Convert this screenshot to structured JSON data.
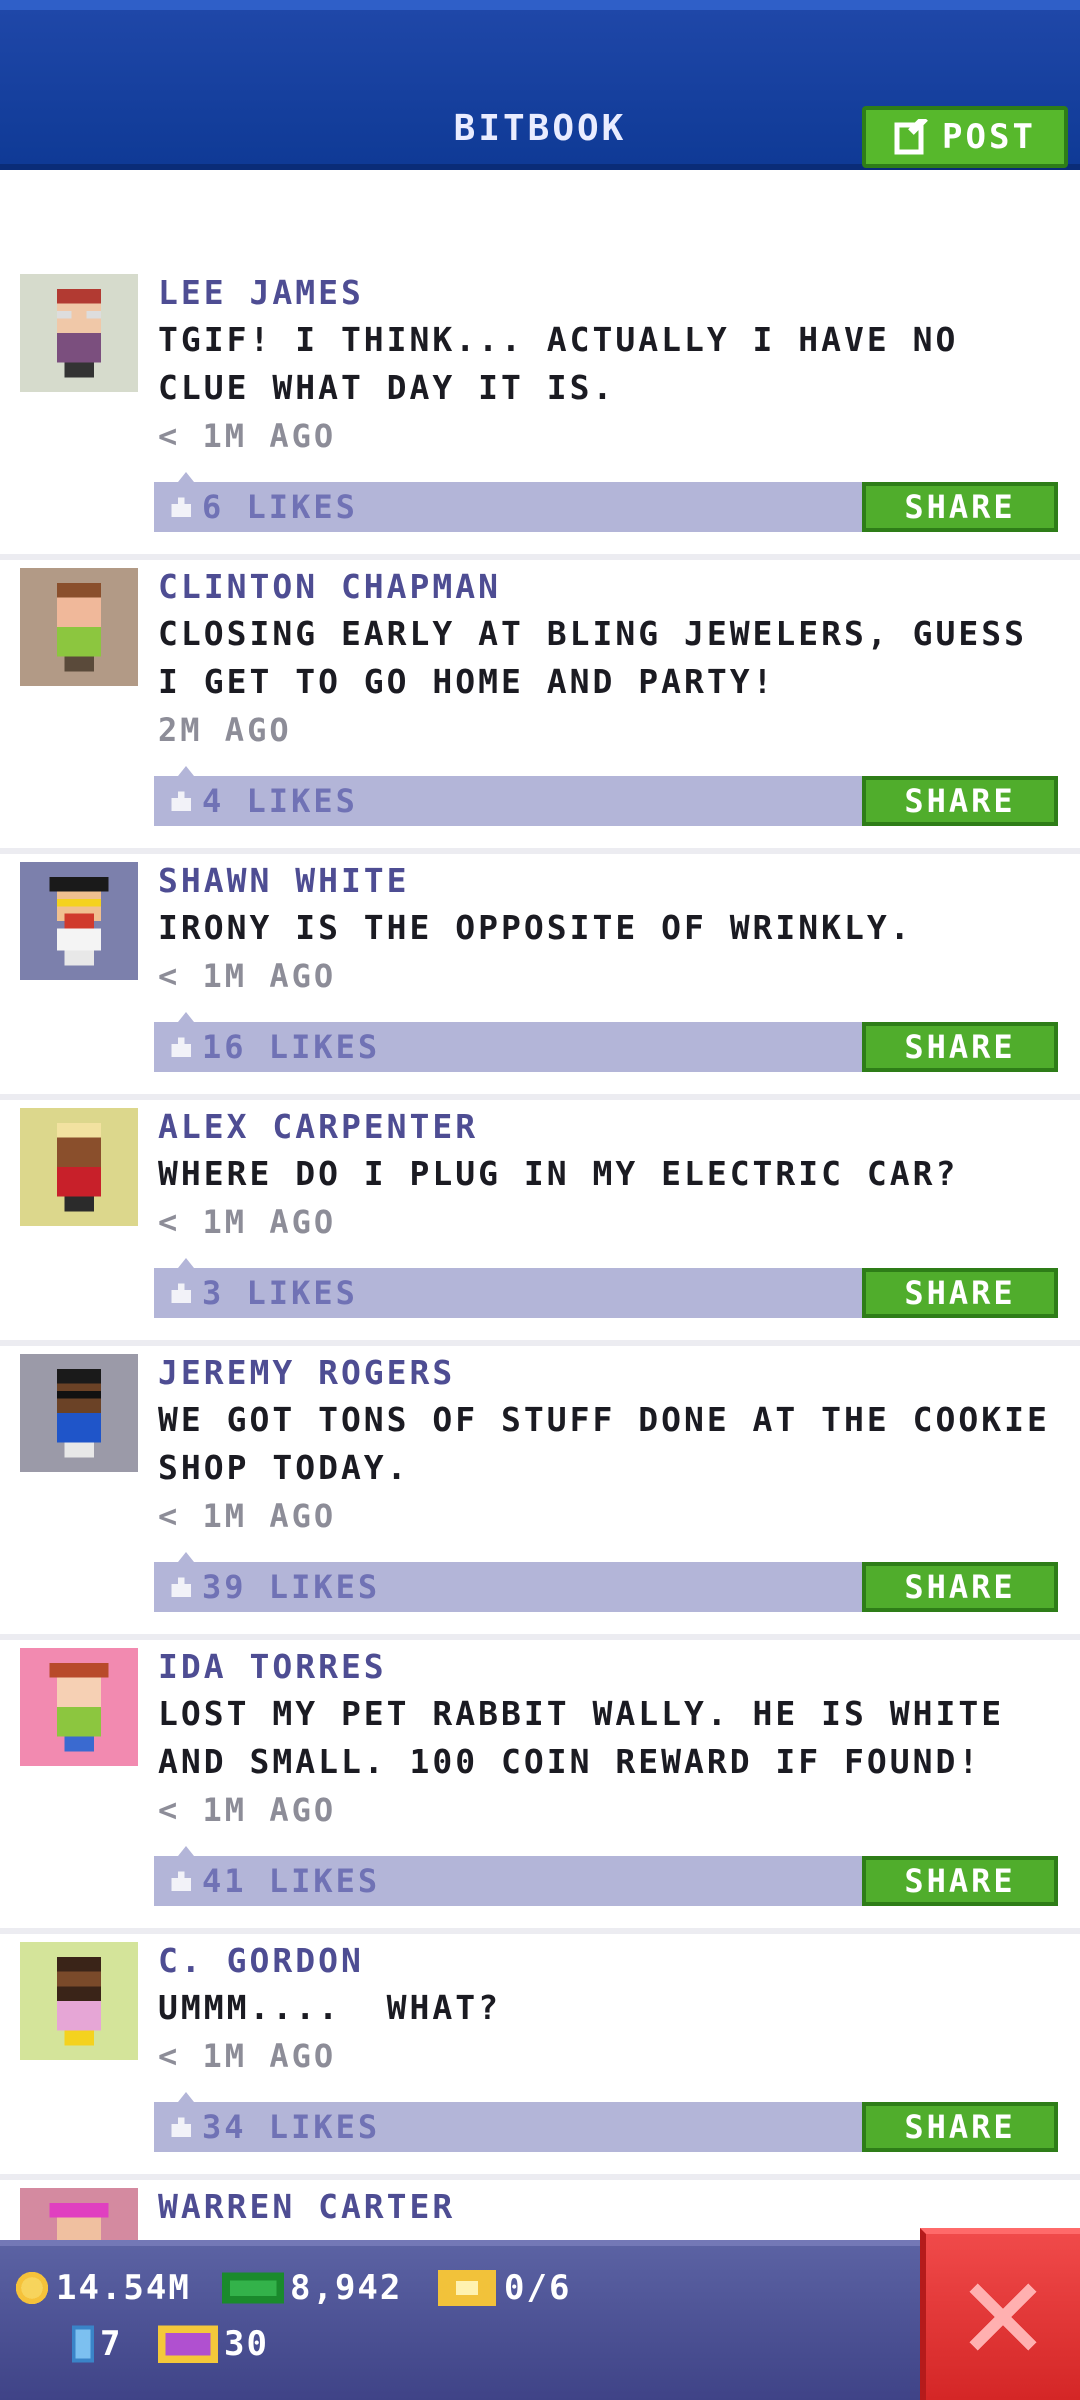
{
  "header": {
    "title": "BITBOOK",
    "post_label": "POST"
  },
  "posts": [
    {
      "author": "LEE JAMES",
      "text": "TGIF! I THINK... ACTUALLY I HAVE NO CLUE WHAT DAY IT IS.",
      "time": "< 1M AGO",
      "likes": "6 LIKES",
      "share": "SHARE"
    },
    {
      "author": "CLINTON CHAPMAN",
      "text": "CLOSING EARLY AT BLING JEWELERS, GUESS I GET TO GO HOME AND PARTY!",
      "time": "2M AGO",
      "likes": "4 LIKES",
      "share": "SHARE"
    },
    {
      "author": "SHAWN WHITE",
      "text": "IRONY IS THE OPPOSITE OF WRINKLY.",
      "time": "< 1M AGO",
      "likes": "16 LIKES",
      "share": "SHARE"
    },
    {
      "author": "ALEX CARPENTER",
      "text": "WHERE DO I PLUG IN MY ELECTRIC CAR?",
      "time": "< 1M AGO",
      "likes": "3 LIKES",
      "share": "SHARE"
    },
    {
      "author": "JEREMY ROGERS",
      "text": "WE GOT TONS OF STUFF DONE AT THE COOKIE SHOP TODAY.",
      "time": "< 1M AGO",
      "likes": "39 LIKES",
      "share": "SHARE"
    },
    {
      "author": "IDA TORRES",
      "text": "LOST MY PET RABBIT WALLY. HE IS WHITE AND SMALL. 100 COIN REWARD IF FOUND!",
      "time": "< 1M AGO",
      "likes": "41 LIKES",
      "share": "SHARE"
    },
    {
      "author": "C. GORDON",
      "text": "UMMM....  WHAT?",
      "time": "< 1M AGO",
      "likes": "34 LIKES",
      "share": "SHARE"
    },
    {
      "author": "WARREN CARTER",
      "text": "",
      "time": "",
      "likes": "",
      "share": ""
    }
  ],
  "status_bar": {
    "coins": "14.54M",
    "bux": "8,942",
    "tickets": "0/6",
    "level_count": "7",
    "vip_count": "30"
  },
  "colors": {
    "header_blue": "#1f47a8",
    "accent_green": "#57b82c",
    "likes_bar": "#b3b5d8",
    "author_purple": "#4e4d93",
    "close_red": "#e03636"
  },
  "icons": [
    "post-edit-icon",
    "thumb-icon",
    "coin-icon",
    "bux-icon",
    "ticket-icon",
    "elevator-icon",
    "vip-icon",
    "close-icon"
  ]
}
